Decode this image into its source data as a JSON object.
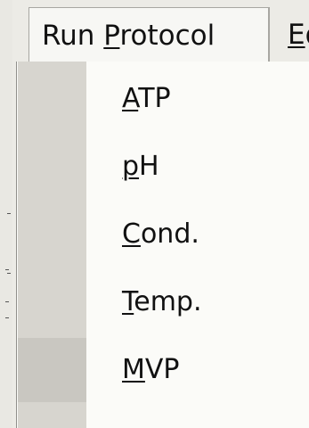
{
  "menubar": {
    "active_menu": {
      "before": "Run ",
      "accel": "P",
      "after": "rotocol"
    },
    "next_menu": {
      "accel": "E",
      "after": "d"
    }
  },
  "menu_items": [
    {
      "accel": "A",
      "rest": "TP"
    },
    {
      "accel": "p",
      "rest": "H"
    },
    {
      "accel": "C",
      "rest": "ond."
    },
    {
      "accel": "T",
      "rest": "emp."
    },
    {
      "accel": "M",
      "rest": "VP"
    }
  ]
}
